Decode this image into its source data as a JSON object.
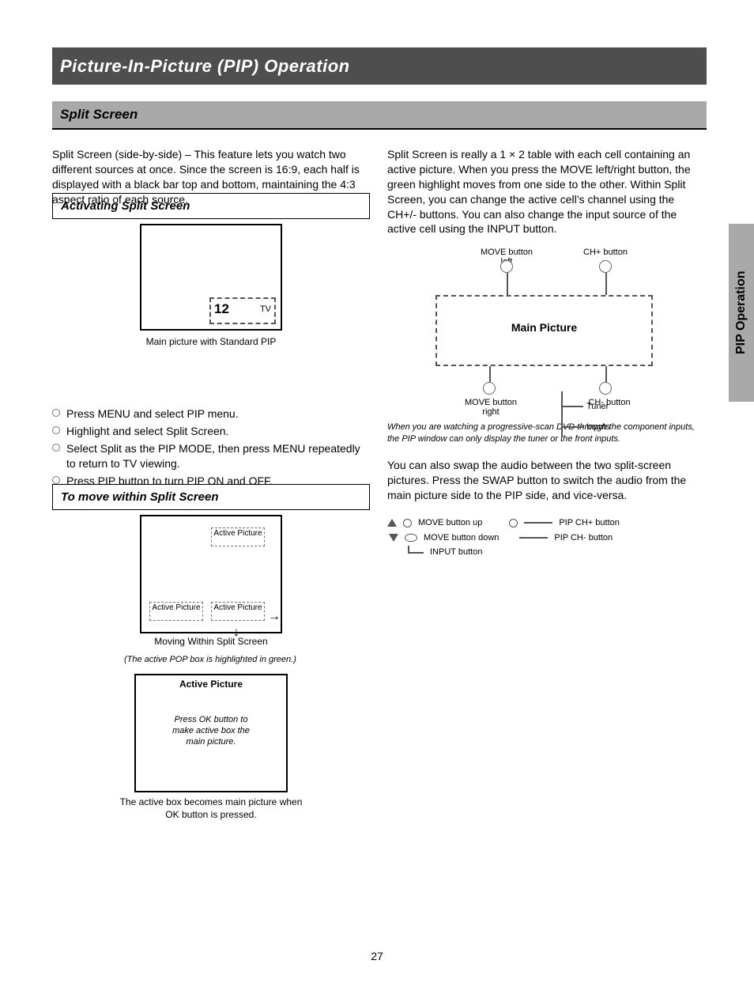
{
  "title_belt": "Picture-In-Picture (PIP) Operation",
  "sub_belt": "Split Screen",
  "side_tab": "PIP Operation",
  "page_number": "27",
  "intro": "Split Screen (side-by-side) – This feature lets you watch two different sources at once. Since the screen is 16:9, each half is displayed with a black bar top and bottom, maintaining the 4:3 aspect ratio of each source.",
  "active_box_h": "Activating Split Screen",
  "tv1_inner_big": "12",
  "tv1_inner_sm": "TV",
  "tv1_caption": "Main picture with Standard PIP",
  "radio_items": [
    "Press MENU and select PIP menu.",
    "Highlight and select Split Screen.",
    "Select Split as the PIP MODE, then press MENU repeatedly to return to TV viewing.",
    "Press PIP button to turn PIP ON and OFF."
  ],
  "move_box_h": "To move within Split Screen",
  "slot_labels": {
    "a": "Active\nPicture",
    "b": "Active\nPicture",
    "c": "Active\nPicture"
  },
  "move_caption": "Moving Within Split Screen",
  "move_warn": "(The active POP box is highlighted in green.)",
  "big_tv_tag": "Active Picture",
  "big_tv_body1": "Press OK button to",
  "big_tv_body2": "make active box the",
  "big_tv_body3": "main picture.",
  "big_tv_caption": "The active box becomes main picture when OK button is pressed.",
  "right_para": "Split Screen is really a 1 × 2 table with each cell containing an active picture. When you press the MOVE left/right button, the green highlight moves from one side to the other. Within Split Screen, you can change the active cell’s channel using the CH+/- buttons. You can also change the input source of the active cell using the INPUT button.",
  "diag": {
    "box_label": "Main Picture",
    "top_left": "MOVE button left",
    "top_right": "CH+ button",
    "bot_left": "MOVE button right",
    "bot_right": "CH- button",
    "tree_1": "Tuner",
    "tree_2": "Inputs"
  },
  "disc_note": "When you are watching a progressive-scan DVD through the component inputs, the PIP window can only display the tuner or the front inputs.",
  "swap_para": "You can also swap the audio between the two split-screen pictures. Press the SWAP button to switch the audio from the main picture side to the PIP side, and vice-versa.",
  "legend": {
    "row1_a": "MOVE button up",
    "row1_b": "PIP CH+ button",
    "row2_a": "MOVE button down",
    "row2_b": "PIP CH- button",
    "row3": "INPUT button"
  }
}
